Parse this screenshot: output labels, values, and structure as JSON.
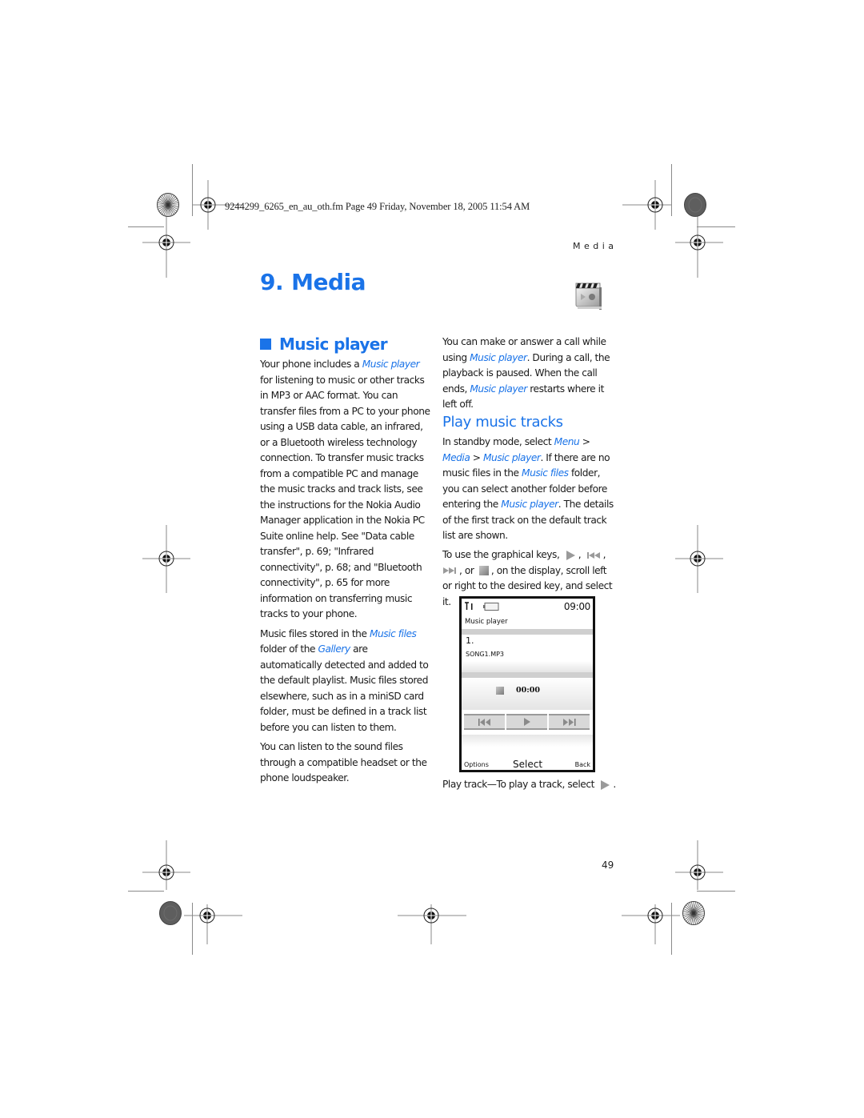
{
  "slug": "9244299_6265_en_au_oth.fm  Page 49  Friday, November 18, 2005  11:54 AM",
  "running_head": "Media",
  "chapter": {
    "number": "9.",
    "title": "Media",
    "icon": "media-clapperboard-icon"
  },
  "section": {
    "title": "Music player",
    "marker_color": "#1a73e8"
  },
  "left_column": {
    "p1": {
      "a": "Your phone includes a ",
      "link": "Music player",
      "b": " for listening to music or other tracks in MP3 or AAC format. You can transfer files from a PC to your phone using a USB data cable, an infrared, or a Bluetooth wireless technology connection. To transfer music tracks from a compatible PC and manage the music tracks and track lists, see the instructions for the Nokia Audio Manager application in the Nokia PC Suite online help. See \"Data cable transfer\", p. 69; \"Infrared connectivity\", p. 68; and \"Bluetooth connectivity\", p. 65 for more information on transferring music tracks to your phone."
    },
    "p2": {
      "a": "Music files stored in the ",
      "link1": "Music files",
      "b": " folder of the ",
      "link2": "Gallery",
      "c": " are automatically detected and added to the default playlist. Music files stored elsewhere, such as in a miniSD card folder, must be defined in a track list before you can listen to them."
    },
    "p3": "You can listen to the sound files through a compatible headset or the phone loudspeaker."
  },
  "right_column": {
    "p1": {
      "a": "You can make or answer a call while using ",
      "link1": "Music player",
      "b": ". During a call, the playback is paused. When the call ends, ",
      "link2": "Music player",
      "c": " restarts where it left off."
    },
    "subsection_title": "Play music tracks",
    "p2": {
      "a": "In standby mode, select ",
      "link1": "Menu",
      "b": " > ",
      "link2": "Media",
      "c": " > ",
      "link3": "Music player",
      "d": ". If there are no music files in the ",
      "link4": "Music files",
      "e": " folder, you can select another folder before entering the ",
      "link5": "Music player",
      "f": ". The details of the first track on the default track list are shown."
    },
    "p3": {
      "a": "To use the graphical keys, ",
      "sep1": ", ",
      "sep2": ",",
      "sep3": ", or ",
      "b": ", on the display, scroll left or right to the desired key, and select it.",
      "icons": [
        "play-icon",
        "rewind-icon",
        "fast-forward-icon",
        "stop-icon"
      ]
    }
  },
  "phone_screen": {
    "time": "09:00",
    "app_title": "Music player",
    "track_number": "1.",
    "track_name": "SONG1.MP3",
    "elapsed": "00:00",
    "softkey_left": "Options",
    "softkey_middle": "Select",
    "softkey_right": "Back"
  },
  "caption": {
    "a": "Play track—To play a track, select ",
    "b": "."
  },
  "page_number": "49",
  "colors": {
    "accent": "#1a73e8",
    "text": "#1a1a1a"
  }
}
